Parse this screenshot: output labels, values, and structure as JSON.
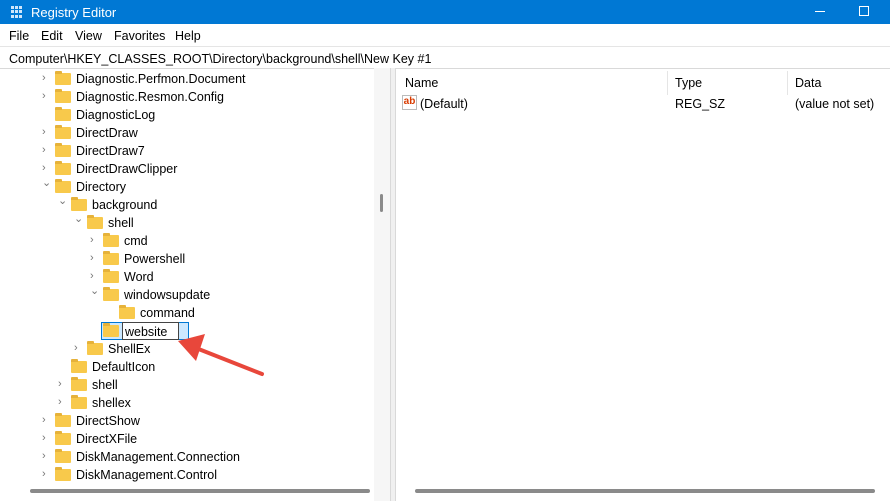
{
  "window": {
    "title": "Registry Editor"
  },
  "menu": [
    "File",
    "Edit",
    "View",
    "Favorites",
    "Help"
  ],
  "address": "Computer\\HKEY_CLASSES_ROOT\\Directory\\background\\shell\\New Key #1",
  "tree": [
    {
      "label": "Diagnostic.Perfmon.Document",
      "level": 0,
      "exp": "collapsed"
    },
    {
      "label": "Diagnostic.Resmon.Config",
      "level": 0,
      "exp": "collapsed"
    },
    {
      "label": "DiagnosticLog",
      "level": 0,
      "exp": "none"
    },
    {
      "label": "DirectDraw",
      "level": 0,
      "exp": "collapsed"
    },
    {
      "label": "DirectDraw7",
      "level": 0,
      "exp": "collapsed"
    },
    {
      "label": "DirectDrawClipper",
      "level": 0,
      "exp": "collapsed"
    },
    {
      "label": "Directory",
      "level": 0,
      "exp": "expanded"
    },
    {
      "label": "background",
      "level": 1,
      "exp": "expanded"
    },
    {
      "label": "shell",
      "level": 2,
      "exp": "expanded"
    },
    {
      "label": "cmd",
      "level": 3,
      "exp": "collapsed"
    },
    {
      "label": "Powershell",
      "level": 3,
      "exp": "collapsed"
    },
    {
      "label": "Word",
      "level": 3,
      "exp": "collapsed"
    },
    {
      "label": "windowsupdate",
      "level": 3,
      "exp": "expanded"
    },
    {
      "label": "command",
      "level": 4,
      "exp": "none"
    },
    {
      "label": "website",
      "level": 3,
      "exp": "none",
      "editing": true
    },
    {
      "label": "ShellEx",
      "level": 2,
      "exp": "collapsed"
    },
    {
      "label": "DefaultIcon",
      "level": 1,
      "exp": "none"
    },
    {
      "label": "shell",
      "level": 1,
      "exp": "collapsed"
    },
    {
      "label": "shellex",
      "level": 1,
      "exp": "collapsed"
    },
    {
      "label": "DirectShow",
      "level": 0,
      "exp": "collapsed"
    },
    {
      "label": "DirectXFile",
      "level": 0,
      "exp": "collapsed"
    },
    {
      "label": "DiskManagement.Connection",
      "level": 0,
      "exp": "collapsed"
    },
    {
      "label": "DiskManagement.Control",
      "level": 0,
      "exp": "collapsed"
    }
  ],
  "list": {
    "headers": [
      "Name",
      "Type",
      "Data"
    ],
    "rows": [
      {
        "name": "(Default)",
        "type": "REG_SZ",
        "data": "(value not set)",
        "icon": "string-value-icon"
      }
    ]
  },
  "colors": {
    "titlebar": "#0078d4",
    "arrow": "#e8473b"
  }
}
